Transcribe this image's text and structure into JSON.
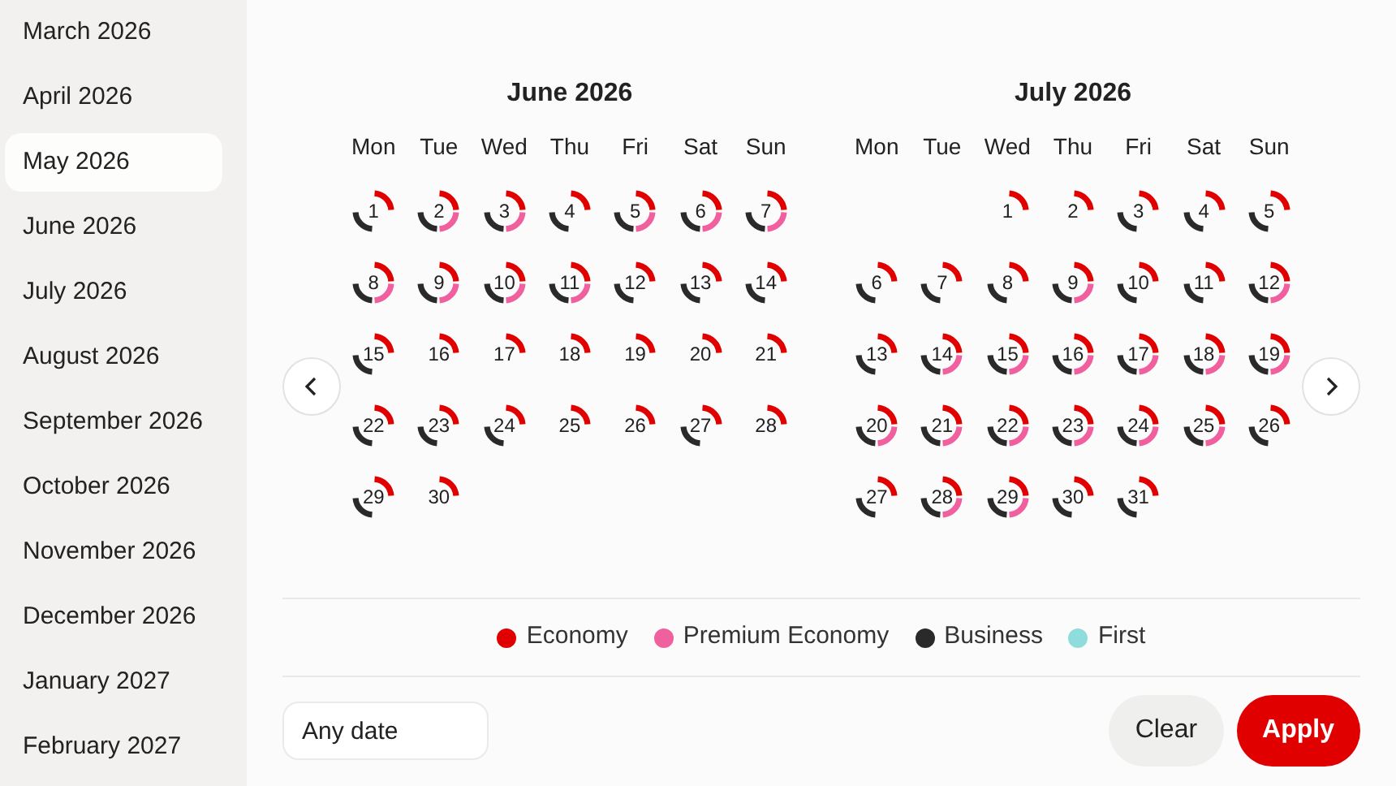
{
  "sidebar": {
    "items": [
      {
        "label": "March 2026",
        "selected": false
      },
      {
        "label": "April 2026",
        "selected": false
      },
      {
        "label": "May 2026",
        "selected": true
      },
      {
        "label": "June 2026",
        "selected": false
      },
      {
        "label": "July 2026",
        "selected": false
      },
      {
        "label": "August 2026",
        "selected": false
      },
      {
        "label": "September 2026",
        "selected": false
      },
      {
        "label": "October 2026",
        "selected": false
      },
      {
        "label": "November 2026",
        "selected": false
      },
      {
        "label": "December 2026",
        "selected": false
      },
      {
        "label": "January 2027",
        "selected": false
      },
      {
        "label": "February 2027",
        "selected": false
      }
    ]
  },
  "months": [
    {
      "title": "June 2026",
      "weekdays": [
        "Mon",
        "Tue",
        "Wed",
        "Thu",
        "Fri",
        "Sat",
        "Sun"
      ],
      "days": [
        {
          "kind": "day",
          "label": "1",
          "economy": true,
          "premium": false,
          "business": true
        },
        {
          "kind": "day",
          "label": "2",
          "economy": true,
          "premium": true,
          "business": true
        },
        {
          "kind": "day",
          "label": "3",
          "economy": true,
          "premium": true,
          "business": true
        },
        {
          "kind": "day",
          "label": "4",
          "economy": true,
          "premium": false,
          "business": true
        },
        {
          "kind": "day",
          "label": "5",
          "economy": true,
          "premium": true,
          "business": true
        },
        {
          "kind": "day",
          "label": "6",
          "economy": true,
          "premium": true,
          "business": true
        },
        {
          "kind": "day",
          "label": "7",
          "economy": true,
          "premium": true,
          "business": true
        },
        {
          "kind": "day",
          "label": "8",
          "economy": true,
          "premium": true,
          "business": true
        },
        {
          "kind": "day",
          "label": "9",
          "economy": true,
          "premium": true,
          "business": true
        },
        {
          "kind": "day",
          "label": "10",
          "economy": true,
          "premium": true,
          "business": true
        },
        {
          "kind": "day",
          "label": "11",
          "economy": true,
          "premium": true,
          "business": true
        },
        {
          "kind": "day",
          "label": "12",
          "economy": true,
          "premium": false,
          "business": true
        },
        {
          "kind": "day",
          "label": "13",
          "economy": true,
          "premium": false,
          "business": true
        },
        {
          "kind": "day",
          "label": "14",
          "economy": true,
          "premium": false,
          "business": true
        },
        {
          "kind": "day",
          "label": "15",
          "economy": true,
          "premium": false,
          "business": true
        },
        {
          "kind": "day",
          "label": "16",
          "economy": true,
          "premium": false,
          "business": false
        },
        {
          "kind": "day",
          "label": "17",
          "economy": true,
          "premium": false,
          "business": false
        },
        {
          "kind": "day",
          "label": "18",
          "economy": true,
          "premium": false,
          "business": false
        },
        {
          "kind": "day",
          "label": "19",
          "economy": true,
          "premium": false,
          "business": false
        },
        {
          "kind": "day",
          "label": "20",
          "economy": true,
          "premium": false,
          "business": false
        },
        {
          "kind": "day",
          "label": "21",
          "economy": true,
          "premium": false,
          "business": false
        },
        {
          "kind": "day",
          "label": "22",
          "economy": true,
          "premium": false,
          "business": true
        },
        {
          "kind": "day",
          "label": "23",
          "economy": true,
          "premium": false,
          "business": true
        },
        {
          "kind": "day",
          "label": "24",
          "economy": true,
          "premium": false,
          "business": true
        },
        {
          "kind": "day",
          "label": "25",
          "economy": true,
          "premium": false,
          "business": false
        },
        {
          "kind": "day",
          "label": "26",
          "economy": true,
          "premium": false,
          "business": false
        },
        {
          "kind": "day",
          "label": "27",
          "economy": true,
          "premium": false,
          "business": true
        },
        {
          "kind": "day",
          "label": "28",
          "economy": true,
          "premium": false,
          "business": false
        },
        {
          "kind": "day",
          "label": "29",
          "economy": true,
          "premium": false,
          "business": true
        },
        {
          "kind": "day",
          "label": "30",
          "economy": true,
          "premium": false,
          "business": false
        }
      ]
    },
    {
      "title": "July 2026",
      "weekdays": [
        "Mon",
        "Tue",
        "Wed",
        "Thu",
        "Fri",
        "Sat",
        "Sun"
      ],
      "days": [
        {
          "kind": "blank"
        },
        {
          "kind": "blank"
        },
        {
          "kind": "day",
          "label": "1",
          "economy": true,
          "premium": false,
          "business": false
        },
        {
          "kind": "day",
          "label": "2",
          "economy": true,
          "premium": false,
          "business": false
        },
        {
          "kind": "day",
          "label": "3",
          "economy": true,
          "premium": false,
          "business": true
        },
        {
          "kind": "day",
          "label": "4",
          "economy": true,
          "premium": false,
          "business": true
        },
        {
          "kind": "day",
          "label": "5",
          "economy": true,
          "premium": false,
          "business": true
        },
        {
          "kind": "day",
          "label": "6",
          "economy": true,
          "premium": false,
          "business": true
        },
        {
          "kind": "day",
          "label": "7",
          "economy": true,
          "premium": false,
          "business": true
        },
        {
          "kind": "day",
          "label": "8",
          "economy": true,
          "premium": false,
          "business": true
        },
        {
          "kind": "day",
          "label": "9",
          "economy": true,
          "premium": true,
          "business": true
        },
        {
          "kind": "day",
          "label": "10",
          "economy": true,
          "premium": false,
          "business": true
        },
        {
          "kind": "day",
          "label": "11",
          "economy": true,
          "premium": false,
          "business": true
        },
        {
          "kind": "day",
          "label": "12",
          "economy": true,
          "premium": true,
          "business": true
        },
        {
          "kind": "day",
          "label": "13",
          "economy": true,
          "premium": false,
          "business": true
        },
        {
          "kind": "day",
          "label": "14",
          "economy": true,
          "premium": true,
          "business": true
        },
        {
          "kind": "day",
          "label": "15",
          "economy": true,
          "premium": true,
          "business": true
        },
        {
          "kind": "day",
          "label": "16",
          "economy": true,
          "premium": true,
          "business": true
        },
        {
          "kind": "day",
          "label": "17",
          "economy": true,
          "premium": true,
          "business": true
        },
        {
          "kind": "day",
          "label": "18",
          "economy": true,
          "premium": true,
          "business": true
        },
        {
          "kind": "day",
          "label": "19",
          "economy": true,
          "premium": true,
          "business": true
        },
        {
          "kind": "day",
          "label": "20",
          "economy": true,
          "premium": true,
          "business": true
        },
        {
          "kind": "day",
          "label": "21",
          "economy": true,
          "premium": true,
          "business": true
        },
        {
          "kind": "day",
          "label": "22",
          "economy": true,
          "premium": true,
          "business": true
        },
        {
          "kind": "day",
          "label": "23",
          "economy": true,
          "premium": true,
          "business": true
        },
        {
          "kind": "day",
          "label": "24",
          "economy": true,
          "premium": true,
          "business": true
        },
        {
          "kind": "day",
          "label": "25",
          "economy": true,
          "premium": true,
          "business": true
        },
        {
          "kind": "day",
          "label": "26",
          "economy": true,
          "premium": false,
          "business": true
        },
        {
          "kind": "day",
          "label": "27",
          "economy": true,
          "premium": false,
          "business": true
        },
        {
          "kind": "day",
          "label": "28",
          "economy": true,
          "premium": true,
          "business": true
        },
        {
          "kind": "day",
          "label": "29",
          "economy": true,
          "premium": true,
          "business": true
        },
        {
          "kind": "day",
          "label": "30",
          "economy": true,
          "premium": false,
          "business": true
        },
        {
          "kind": "day",
          "label": "31",
          "economy": true,
          "premium": false,
          "business": true
        }
      ]
    }
  ],
  "legend": [
    {
      "label": "Economy",
      "color": "#e00000"
    },
    {
      "label": "Premium Economy",
      "color": "#f0609e"
    },
    {
      "label": "Business",
      "color": "#2a2a2a"
    },
    {
      "label": "First",
      "color": "#8fdcdc"
    }
  ],
  "date_field": {
    "value": "Any date"
  },
  "buttons": [
    {
      "label": "Clear",
      "kind": "secondary"
    },
    {
      "label": "Apply",
      "kind": "primary"
    }
  ]
}
